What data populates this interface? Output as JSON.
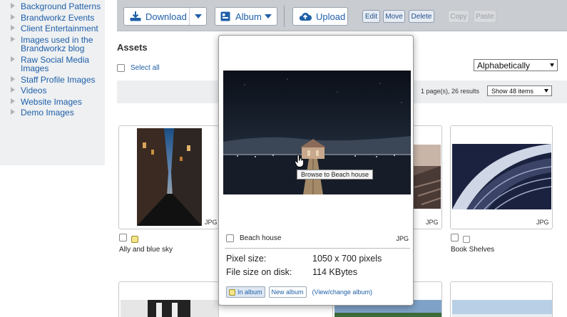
{
  "sidebar": {
    "items": [
      {
        "label": "Background Patterns"
      },
      {
        "label": "Brandworkz Events"
      },
      {
        "label": "Client Entertainment"
      },
      {
        "label": "Images used in the Brandworkz blog"
      },
      {
        "label": "Raw Social Media Images"
      },
      {
        "label": "Staff Profile Images"
      },
      {
        "label": "Videos"
      },
      {
        "label": "Website Images"
      },
      {
        "label": "Demo Images"
      }
    ]
  },
  "toolbar": {
    "download_label": "Download",
    "album_label": "Album",
    "upload_label": "Upload",
    "edit_label": "Edit",
    "move_label": "Move",
    "delete_label": "Delete",
    "copy_label": "Copy",
    "paste_label": "Paste"
  },
  "assets": {
    "title": "Assets",
    "select_all": "Select all",
    "sort_value": "Alphabetically",
    "results_text": "1 page(s), 26 results",
    "show_value": "Show 48 items"
  },
  "cards": [
    {
      "filetype": "JPG",
      "caption": "Ally and blue sky"
    },
    {
      "filetype": "JPG"
    },
    {
      "filetype": "JPG",
      "caption": "Book Shelves"
    }
  ],
  "popup": {
    "tooltip": "Browse to Beach house",
    "name": "Beach house",
    "filetype": "JPG",
    "pixel_label": "Pixel size:",
    "pixel_value": "1050 x 700 pixels",
    "filesize_label": "File size on disk:",
    "filesize_value": "114 KBytes",
    "in_album": "In album",
    "new_album": "New album",
    "view_change": "(View/change album)"
  },
  "colors": {
    "link": "#1f5fa8",
    "toolbar_bg": "#c9ccd0",
    "sidebar_bg": "#eef0f2"
  }
}
